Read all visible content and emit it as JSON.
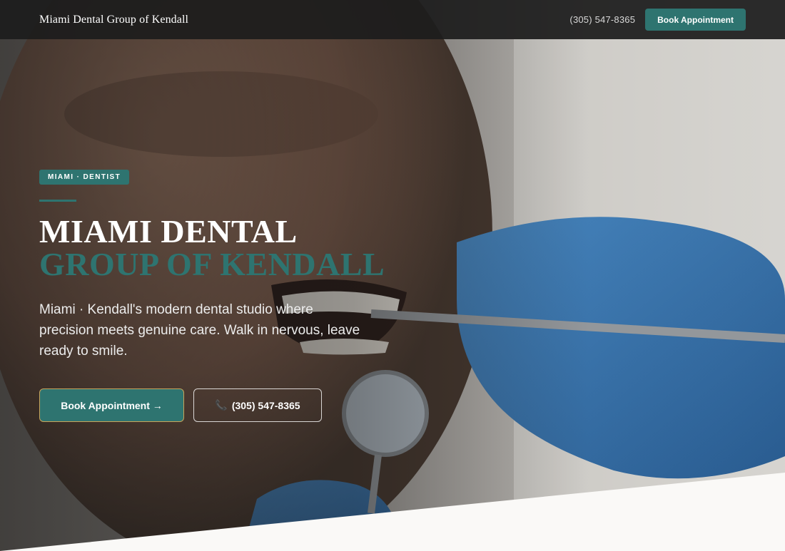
{
  "header": {
    "brand": "Miami Dental Group of Kendall",
    "phone": "(305) 547-8365",
    "book_label": "Book Appointment"
  },
  "hero": {
    "tag": "MIAMI · DENTIST",
    "title_line1": "MIAMI DENTAL",
    "title_line2": "GROUP OF KENDALL",
    "subtitle": "Miami · Kendall's modern dental studio where precision meets genuine care. Walk in nervous, leave ready to smile.",
    "primary_button": "Book Appointment →",
    "secondary_button": "(305) 547-8365",
    "phone_icon": "phone-icon"
  },
  "colors": {
    "accent": "#2e7470",
    "button_border": "#c9a45a",
    "topbar": "#1c1c1c",
    "background": "#faf9f7"
  }
}
